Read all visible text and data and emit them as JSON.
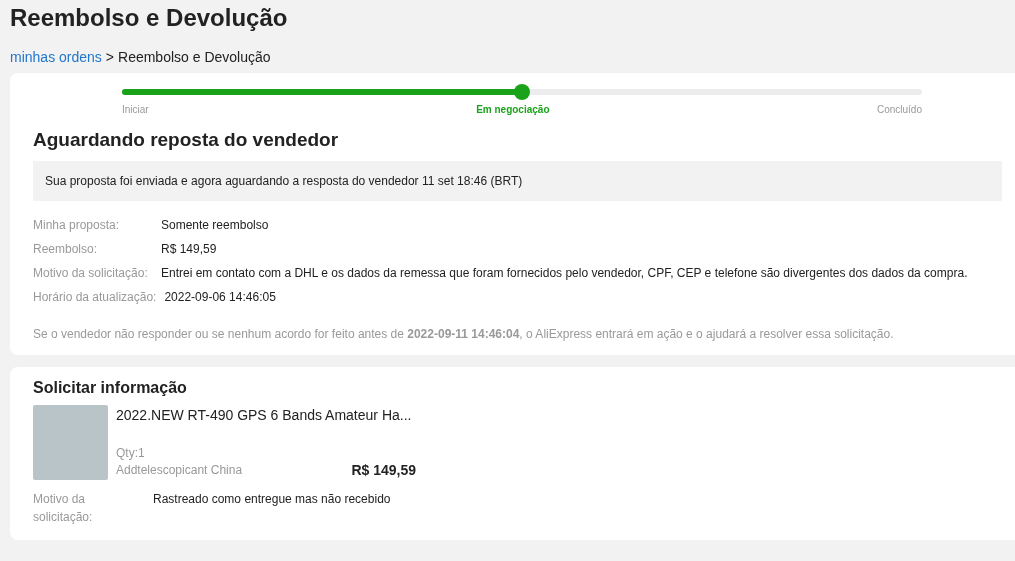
{
  "page_title": "Reembolso e Devolução",
  "breadcrumb": {
    "link": "minhas ordens",
    "separator": ">",
    "current": "Reembolso e Devolução"
  },
  "progress": {
    "level": 0.5,
    "steps": [
      {
        "label": "Iniciar",
        "selected": false
      },
      {
        "label": "Em negociação",
        "selected": true
      },
      {
        "label": "Concluído",
        "selected": false
      }
    ]
  },
  "status": {
    "title": "Aguardando reposta do vendedor",
    "notice": "Sua proposta foi enviada e agora aguardando a resposta do vendedor 11 set 18:46 (BRT)",
    "details": [
      {
        "label": "Minha proposta:",
        "value": "Somente reembolso"
      },
      {
        "label": "Reembolso:",
        "value": "R$ 149,59"
      },
      {
        "label": "Motivo da solicitação:",
        "value": "Entrei em contato com a DHL e os dados da remessa que foram fornecidos pelo vendedor, CPF, CEP e telefone são divergentes dos dados da compra."
      },
      {
        "label": "Horário da atualização:",
        "value": "2022-09-06 14:46:05"
      }
    ],
    "footnote": "Se o vendedor não responder ou se nenhum acordo for feito antes de **2022-09-11 14:46:04**, o AliExpress entrará em ação e o ajudará a resolver essa solicitação."
  },
  "request": {
    "title": "Solicitar informação",
    "product": {
      "name": "2022.NEW RT-490 GPS 6 Bands Amateur Ha...",
      "qty": "Qty:1",
      "variant": "Addtelescopicant China",
      "price": "R$ 149,59"
    },
    "reason": {
      "label": "Motivo da solicitação:",
      "value": "Rastreado como entregue mas não recebido"
    }
  }
}
